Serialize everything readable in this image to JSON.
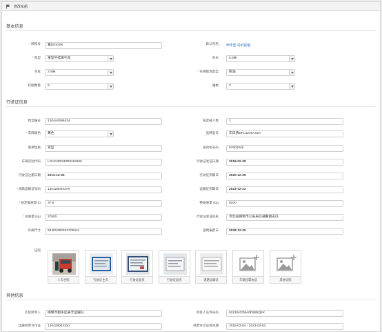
{
  "window": {
    "title": "修改车船"
  },
  "sections": {
    "basic": "基本信息",
    "license": "行驶证信息",
    "other": "其他信息"
  },
  "basic": {
    "plate_label": "牌照号",
    "plate_value": "冀DE5208",
    "driver_label": "默认司机",
    "driver_link": "申传宝 司机管理",
    "cartype_label": "车型",
    "cartype_value": "重型半挂牵引车",
    "length_label": "车长",
    "length_value": "6.8米",
    "width_label": "车宽",
    "width_value": "2.5米",
    "energy_label": "车辆能源类型",
    "energy_value": "柴油",
    "wheels_label": "轮胎数量",
    "wheels_value": "6",
    "axles_label": "轴数",
    "axles_value": "3"
  },
  "license": {
    "record_no_label": "档案编号",
    "record_no_value": "1304A0096434",
    "seats_label": "核定载人数",
    "seats_value": "2",
    "plate_color_label": "车牌颜色",
    "plate_color_value": "黄色",
    "model_label": "品牌型号",
    "model_value": "东风牌DFL4240AX2A",
    "usage_label": "使用性质",
    "usage_value": "货运",
    "engine_label": "发动机号码",
    "engine_value": "87602046",
    "vin_label": "车辆识别代码",
    "vin_value": "LGAG4DX33D8118266",
    "issue_date_label": "行驶证发证日期",
    "issue_date_value": "2019-02-28",
    "reg_date_label": "行驶证注册日期",
    "reg_date_value": "2013-12-25",
    "expire_date_label": "行驶证到期日",
    "expire_date_value": "2020-12-25",
    "transport_no_label": "道路运输证号码",
    "transport_no_value": "130428042378",
    "transport_expire_label": "运输证到期日",
    "transport_expire_value": "2023-12-23",
    "rated_mass_label": "核定载质量 (t)",
    "rated_mass_value": "37.6",
    "curb_mass_label": "整备质量 (kg)",
    "curb_mass_value": "8200",
    "total_mass_label": "总质量 (kg)",
    "total_mass_value": "37600",
    "authority_label": "行驶证发证机关",
    "authority_value": "河北省邯郸市公安局交通警察支队",
    "dims_label": "外廓尺寸",
    "dims_value": "6940X2500X3700mm",
    "scrap_label": "强制报废日",
    "scrap_value": "2028-12-25",
    "photos_label": "证照",
    "photos": [
      {
        "caption": "人车合照",
        "icon": "vehicle-photo"
      },
      {
        "caption": "行驶证主页",
        "icon": "document-photo"
      },
      {
        "caption": "行驶证副页",
        "icon": "document-photo"
      },
      {
        "caption": "行驶证副页",
        "icon": "document-photo"
      },
      {
        "caption": "道路运输证",
        "icon": "document-photo"
      },
      {
        "caption": "车辆挂靠协议",
        "icon": "add-image-icon"
      },
      {
        "caption": "其他证照",
        "icon": "add-image-icon"
      }
    ]
  },
  "other": {
    "owner_label": "实际所有人",
    "owner_value": "邯郸市肥乡区县丰运输队",
    "owner_cert_label": "所有人证件号码",
    "owner_cert_value": "91130407MA0D885Q9X",
    "permit_label": "运输经营许可证",
    "permit_value": "130428002310",
    "permit_validity_label": "经营许可证有效期",
    "permit_validity_value": "2019-03-04 - 2023-03-03"
  },
  "colors": {
    "required": "#e0322d",
    "link": "#2a72c5"
  }
}
